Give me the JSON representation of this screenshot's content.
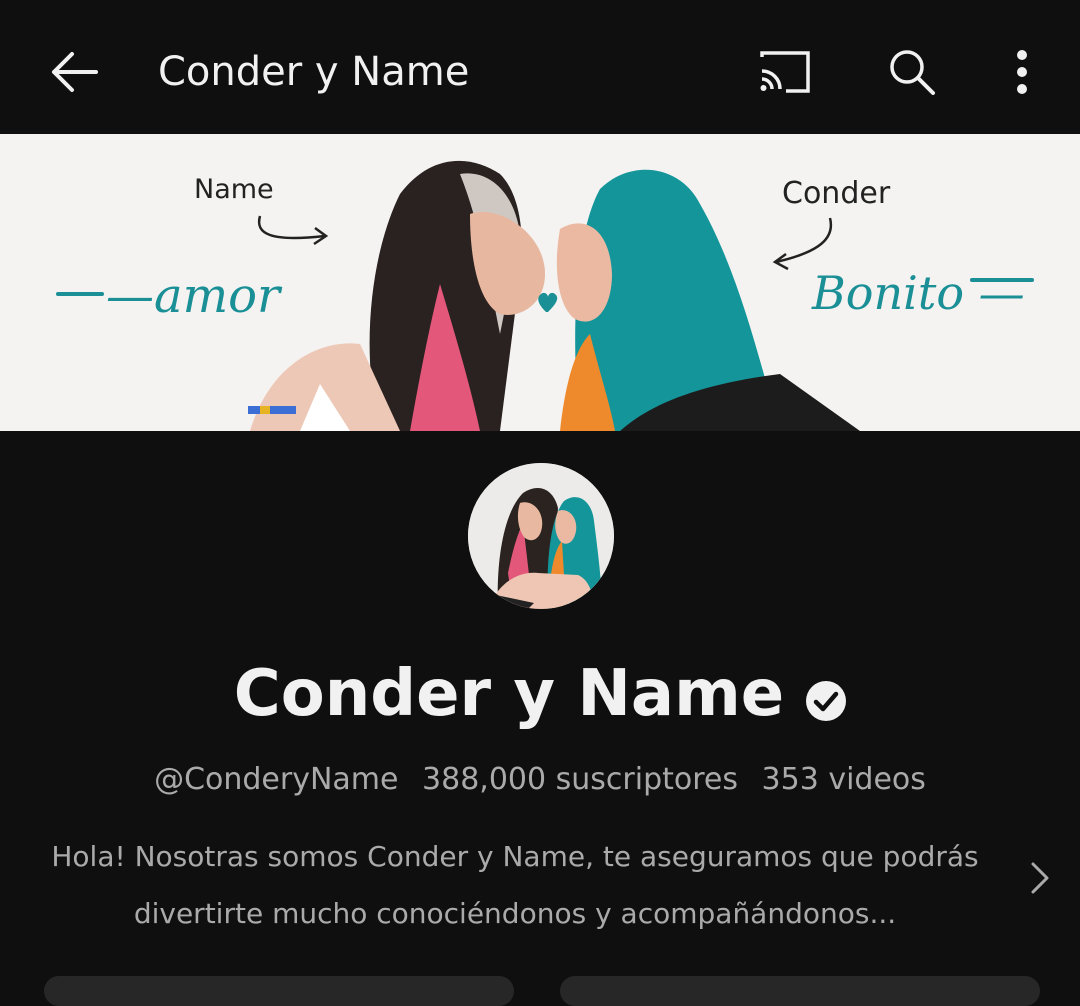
{
  "appbar": {
    "title": "Conder y Name",
    "icons": [
      "back-arrow-icon",
      "cast-icon",
      "search-icon",
      "more-vert-icon"
    ]
  },
  "banner": {
    "note_left": "Name",
    "note_right": "Conder",
    "word_left": "—amor",
    "word_right": "Bonito —"
  },
  "channel": {
    "name": "Conder y Name",
    "verified": true,
    "handle": "@ConderyName",
    "subscribers": "388,000 suscriptores",
    "videos": "353 videos",
    "description": "Hola! Nosotras somos Conder y Name, te aseguramos que podrás divertirte mucho conociéndonos y acompañándonos..."
  },
  "colors": {
    "background": "#0f0f0f",
    "text_primary": "#f1f1f1",
    "text_secondary": "#aaaaaa",
    "accent_teal": "#1a8f96"
  }
}
